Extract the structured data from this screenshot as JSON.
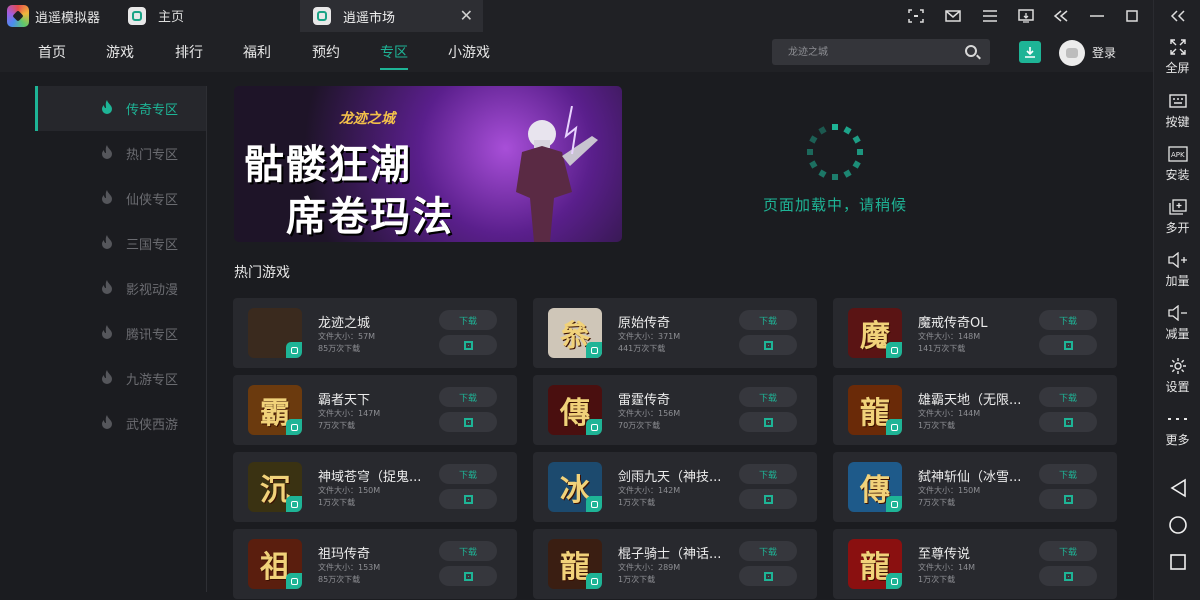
{
  "title_bar": {
    "app_name": "逍遥模拟器",
    "tab_home": "主页",
    "tab_market": "逍遥市场",
    "tab_close": "✕"
  },
  "nav": {
    "items": [
      "首页",
      "游戏",
      "排行",
      "福利",
      "预约",
      "专区",
      "小游戏"
    ],
    "active": "专区",
    "search_placeholder": "龙迹之城",
    "login": "登录"
  },
  "sidebar": {
    "items": [
      "传奇专区",
      "热门专区",
      "仙侠专区",
      "三国专区",
      "影视动漫",
      "腾讯专区",
      "九游专区",
      "武侠西游"
    ],
    "active": "传奇专区"
  },
  "banner": {
    "logo_text": "龙迹之城",
    "line1": "骷髅狂潮",
    "line2": "席卷玛法"
  },
  "loading": {
    "text": "页面加载中，请稍候"
  },
  "hot_games": {
    "title": "热门游戏",
    "download_label": "下载",
    "games": [
      {
        "name": "龙迹之城",
        "size": "文件大小：57M",
        "downloads": "85万次下载",
        "glyph": "",
        "color": "#3a2a1e"
      },
      {
        "name": "原始传奇",
        "size": "文件大小：371M",
        "downloads": "441万次下载",
        "glyph": "叅",
        "color": "#cfc6b8"
      },
      {
        "name": "魔戒传奇OL",
        "size": "文件大小：148M",
        "downloads": "141万次下载",
        "glyph": "魔",
        "color": "#5a1414"
      },
      {
        "name": "霸者天下",
        "size": "文件大小：147M",
        "downloads": "7万次下载",
        "glyph": "霸",
        "color": "#6b3a0e"
      },
      {
        "name": "雷霆传奇",
        "size": "文件大小：156M",
        "downloads": "70万次下载",
        "glyph": "傳",
        "color": "#4a0f0f"
      },
      {
        "name": "雄霸天地（无限...",
        "size": "文件大小：144M",
        "downloads": "1万次下载",
        "glyph": "龍",
        "color": "#6a2a08"
      },
      {
        "name": "神域苍穹（捉鬼...",
        "size": "文件大小：150M",
        "downloads": "1万次下载",
        "glyph": "沉",
        "color": "#3a3212"
      },
      {
        "name": "剑雨九天（神技...",
        "size": "文件大小：142M",
        "downloads": "1万次下载",
        "glyph": "冰",
        "color": "#1c4a6e"
      },
      {
        "name": "弑神斩仙（冰雪...",
        "size": "文件大小：150M",
        "downloads": "7万次下载",
        "glyph": "傳",
        "color": "#1e5a8a"
      },
      {
        "name": "祖玛传奇",
        "size": "文件大小：153M",
        "downloads": "85万次下载",
        "glyph": "祖",
        "color": "#5a1e0e"
      },
      {
        "name": "棍子骑士（神话...",
        "size": "文件大小：289M",
        "downloads": "1万次下载",
        "glyph": "龍",
        "color": "#3a1e12"
      },
      {
        "name": "至尊传说",
        "size": "文件大小：14M",
        "downloads": "1万次下载",
        "glyph": "龍",
        "color": "#8a1010"
      }
    ]
  },
  "rail": {
    "items": [
      "全屏",
      "按键",
      "安装",
      "多开",
      "加量",
      "减量",
      "设置",
      "更多"
    ]
  },
  "colors": {
    "accent": "#1eb496",
    "background": "#1b1c20",
    "card": "#28292e"
  }
}
